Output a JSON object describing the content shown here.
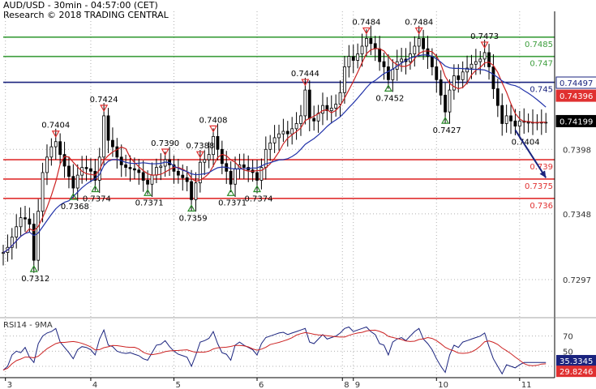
{
  "header": {
    "title": "AUD/USD - 30min - 04:57:00 (CET)",
    "subtitle": "Research © 2018 TRADING CENTRAL"
  },
  "chart_data": [
    {
      "type": "line",
      "panel": "price",
      "ylim": [
        0.727,
        0.7505
      ],
      "price_ticks": [
        "0.7398",
        "0.7348",
        "0.7297"
      ],
      "x_day_labels": [
        {
          "label": "3",
          "t": 0.5
        },
        {
          "label": "4",
          "t": 20
        },
        {
          "label": "5",
          "t": 39
        },
        {
          "label": "6",
          "t": 58
        },
        {
          "label": "8",
          "t": 77.5
        },
        {
          "label": "9",
          "t": 80
        },
        {
          "label": "10",
          "t": 99
        },
        {
          "label": "11",
          "t": 118
        }
      ],
      "t_range": [
        0,
        126
      ],
      "levels": [
        {
          "value": 0.7485,
          "label": "0.7485",
          "color": "#3d9e3d",
          "kind": "resistance"
        },
        {
          "value": 0.747,
          "label": "0.747",
          "color": "#3d9e3d",
          "kind": "resistance"
        },
        {
          "value": 0.745,
          "label": "0.745",
          "color": "#1a237e",
          "kind": "pivot"
        },
        {
          "value": 0.739,
          "label": "0.739",
          "color": "#e03030",
          "kind": "support"
        },
        {
          "value": 0.7375,
          "label": "0.7375",
          "color": "#e03030",
          "kind": "support"
        },
        {
          "value": 0.736,
          "label": "0.736",
          "color": "#e03030",
          "kind": "support"
        }
      ],
      "price_series": {
        "name": "",
        "t": [
          0,
          1,
          2,
          3,
          4,
          5,
          6,
          7,
          8,
          9,
          10,
          11,
          12,
          13,
          14,
          15,
          16,
          17,
          18,
          19,
          20,
          21,
          22,
          23,
          24,
          25,
          26,
          27,
          28,
          29,
          30,
          31,
          32,
          33,
          34,
          35,
          36,
          37,
          38,
          39,
          40,
          41,
          42,
          43,
          44,
          45,
          46,
          47,
          48,
          49,
          50,
          51,
          52,
          53,
          54,
          55,
          56,
          57,
          58,
          59,
          60,
          61,
          62,
          63,
          64,
          65,
          66,
          67,
          68,
          69,
          70,
          71,
          72,
          73,
          74,
          75,
          76,
          77,
          78,
          79,
          80,
          81,
          82,
          83,
          84,
          85,
          86,
          87,
          88,
          89,
          90,
          91,
          92,
          93,
          94,
          95,
          96,
          97,
          98,
          99,
          100,
          101,
          102,
          103,
          104,
          105,
          106,
          107,
          108,
          109,
          110,
          111,
          112,
          113,
          114,
          115,
          116,
          117,
          118,
          119,
          120,
          121,
          122,
          123,
          124
        ],
        "values": [
          0.7318,
          0.7322,
          0.733,
          0.7338,
          0.7345,
          0.7344,
          0.734,
          0.7312,
          0.735,
          0.738,
          0.7392,
          0.74,
          0.7404,
          0.7394,
          0.7385,
          0.7377,
          0.7368,
          0.7378,
          0.7384,
          0.7383,
          0.7381,
          0.7374,
          0.7392,
          0.7424,
          0.7405,
          0.74,
          0.7392,
          0.7386,
          0.7384,
          0.7383,
          0.7382,
          0.738,
          0.7374,
          0.7371,
          0.7378,
          0.7384,
          0.7385,
          0.739,
          0.7386,
          0.7381,
          0.7378,
          0.7376,
          0.7373,
          0.7359,
          0.7372,
          0.7388,
          0.739,
          0.7394,
          0.7408,
          0.7398,
          0.7387,
          0.7381,
          0.7371,
          0.7383,
          0.7386,
          0.7384,
          0.7382,
          0.738,
          0.7374,
          0.7384,
          0.7398,
          0.7403,
          0.7407,
          0.741,
          0.7412,
          0.741,
          0.7414,
          0.7418,
          0.7424,
          0.7444,
          0.7422,
          0.742,
          0.7426,
          0.7432,
          0.7428,
          0.743,
          0.7433,
          0.7442,
          0.7462,
          0.747,
          0.7467,
          0.7472,
          0.7478,
          0.7484,
          0.748,
          0.7476,
          0.7466,
          0.7462,
          0.7452,
          0.746,
          0.7466,
          0.7468,
          0.7466,
          0.7472,
          0.7478,
          0.7484,
          0.7476,
          0.747,
          0.7462,
          0.7452,
          0.744,
          0.7427,
          0.7444,
          0.7455,
          0.7452,
          0.7458,
          0.7461,
          0.7464,
          0.7466,
          0.7468,
          0.7473,
          0.7462,
          0.7445,
          0.7432,
          0.7418,
          0.7424,
          0.742,
          0.7416,
          0.742,
          0.7419,
          0.7419,
          0.7419,
          0.7419,
          0.7419,
          0.7419
        ]
      },
      "ma_series": [
        {
          "name": "",
          "color": "#cc2222",
          "role": "fast"
        },
        {
          "name": "",
          "color": "#2233aa",
          "role": "slow"
        }
      ],
      "annotations": [
        {
          "label": "0.7404",
          "t": 12,
          "v": 0.7404,
          "type": "high"
        },
        {
          "label": "0.7368",
          "t": 16,
          "v": 0.7368,
          "type": "low"
        },
        {
          "label": "0.7312",
          "t": 7,
          "v": 0.7312,
          "type": "low"
        },
        {
          "label": "0.7424",
          "t": 23,
          "v": 0.7424,
          "type": "high"
        },
        {
          "label": "0.7374",
          "t": 21,
          "v": 0.7374,
          "type": "low"
        },
        {
          "label": "0.7390",
          "t": 37,
          "v": 0.739,
          "type": "high"
        },
        {
          "label": "0.7388",
          "t": 45,
          "v": 0.7388,
          "type": "high"
        },
        {
          "label": "0.7371",
          "t": 33,
          "v": 0.7371,
          "type": "low"
        },
        {
          "label": "0.7359",
          "t": 43,
          "v": 0.7359,
          "type": "low"
        },
        {
          "label": "0.7408",
          "t": 48,
          "v": 0.7408,
          "type": "high"
        },
        {
          "label": "0.7371",
          "t": 52,
          "v": 0.7371,
          "type": "low"
        },
        {
          "label": "0.7374",
          "t": 58,
          "v": 0.7374,
          "type": "low"
        },
        {
          "label": "0.7444",
          "t": 69,
          "v": 0.7444,
          "type": "high"
        },
        {
          "label": "0.7484",
          "t": 83,
          "v": 0.7484,
          "type": "high"
        },
        {
          "label": "0.7452",
          "t": 88,
          "v": 0.7452,
          "type": "low"
        },
        {
          "label": "0.7484",
          "t": 95,
          "v": 0.7484,
          "type": "high"
        },
        {
          "label": "0.7427",
          "t": 101,
          "v": 0.7427,
          "type": "low"
        },
        {
          "label": "0.7473",
          "t": 110,
          "v": 0.7473,
          "type": "high"
        },
        {
          "label": "0.7404",
          "t": 115,
          "v": 0.7404,
          "type": "target"
        }
      ],
      "forecast_arrow": {
        "from": {
          "t": 117,
          "v": 0.7413
        },
        "to": {
          "t": 124,
          "v": 0.7376
        },
        "color": "#1a237e"
      },
      "badges": [
        {
          "label": "0.74497",
          "value": 0.74497,
          "bg": "#ffffff",
          "fg": "#1a237e",
          "border": "#1a237e"
        },
        {
          "label": "0.74396",
          "value": 0.74396,
          "bg": "#e03030",
          "fg": "#ffffff",
          "border": "#e03030"
        },
        {
          "label": "0.74199",
          "value": 0.74199,
          "bg": "#000000",
          "fg": "#ffffff",
          "border": "#000000"
        }
      ]
    },
    {
      "type": "line",
      "panel": "rsi",
      "title": "RSI14 - 9MA",
      "ylim": [
        15,
        90
      ],
      "ticks": [
        "70",
        "50",
        "30"
      ],
      "rsi_series": {
        "name": "",
        "values": [
          25,
          30,
          45,
          50,
          48,
          55,
          42,
          35,
          60,
          70,
          74,
          76,
          80,
          62,
          55,
          48,
          40,
          52,
          56,
          55,
          52,
          45,
          66,
          78,
          58,
          56,
          50,
          48,
          47,
          48,
          46,
          44,
          40,
          38,
          48,
          58,
          59,
          64,
          56,
          50,
          46,
          44,
          42,
          30,
          45,
          62,
          64,
          67,
          76,
          60,
          48,
          46,
          38,
          58,
          62,
          58,
          55,
          52,
          45,
          60,
          68,
          70,
          72,
          74,
          75,
          72,
          74,
          76,
          78,
          80,
          62,
          60,
          66,
          72,
          66,
          68,
          70,
          74,
          80,
          82,
          76,
          78,
          80,
          82,
          76,
          72,
          60,
          58,
          45,
          62,
          66,
          68,
          64,
          70,
          76,
          80,
          66,
          60,
          52,
          40,
          30,
          22,
          45,
          58,
          55,
          62,
          64,
          66,
          68,
          70,
          74,
          56,
          40,
          30,
          20,
          32,
          30,
          28,
          32,
          35,
          35,
          35,
          35,
          35,
          35
        ]
      },
      "ma_series": {
        "name": "",
        "color": "#cc2222"
      },
      "badges": [
        {
          "label": "35.3345",
          "value": 35.33,
          "bg": "#1a237e",
          "fg": "#ffffff"
        },
        {
          "label": "29.8246",
          "value": 29.82,
          "bg": "#e03030",
          "fg": "#ffffff"
        }
      ]
    }
  ],
  "colors": {
    "candle": "#000000",
    "grid": "#b0b0b0",
    "axis": "#000000",
    "high_marker": "#e03030",
    "low_marker": "#2a8a2a"
  }
}
